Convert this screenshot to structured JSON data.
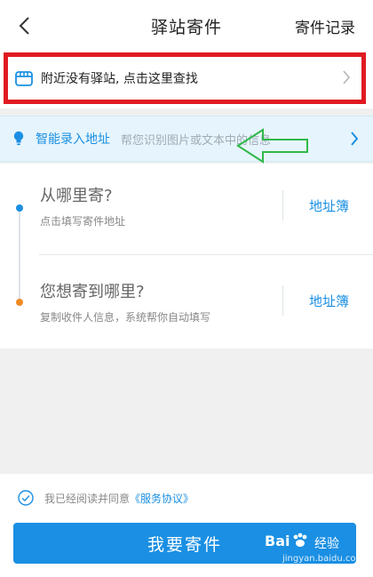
{
  "header": {
    "title": "驿站寄件",
    "records_label": "寄件记录"
  },
  "station": {
    "text": "附近没有驿站, 点击这里查找"
  },
  "smart_entry": {
    "label": "智能录入地址",
    "hint": "帮您识别图片或文本中的信息"
  },
  "sender": {
    "title": "从哪里寄?",
    "subtitle": "点击填写寄件地址",
    "book_label": "地址簿"
  },
  "receiver": {
    "title": "您想寄到哪里?",
    "subtitle": "复制收件人信息，系统帮你自动填写",
    "book_label": "地址簿"
  },
  "agreement": {
    "prefix": "我已经阅读并同意",
    "link": "《服务协议》"
  },
  "send_button": {
    "label": "我要寄件"
  },
  "watermark": {
    "brand": "Bai",
    "brand2": "经验",
    "url": "jingyan.baidu.com"
  },
  "colors": {
    "accent": "#1a8fe3",
    "highlight_red": "#e01a22",
    "annotation_green": "#2fb84a",
    "orange": "#f08a24"
  }
}
